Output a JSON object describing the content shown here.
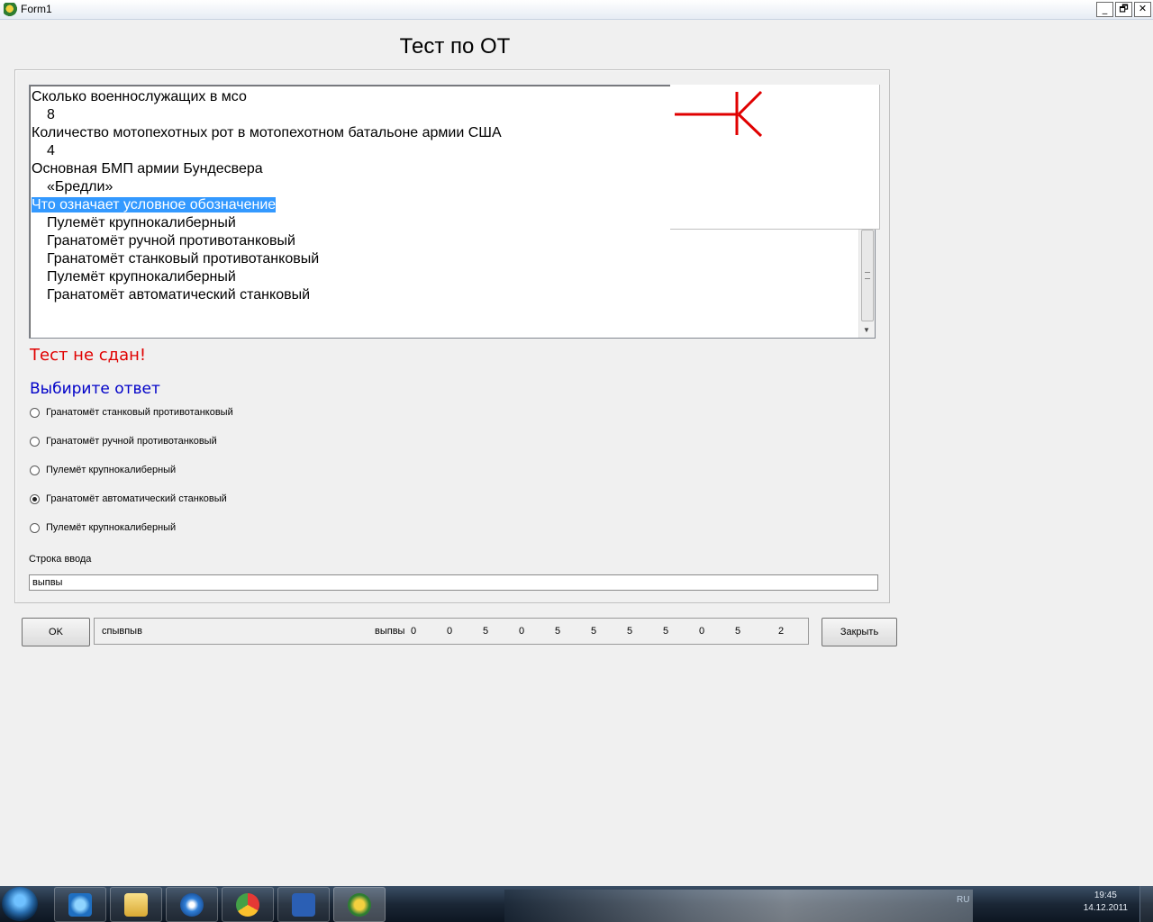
{
  "window": {
    "title": "Form1",
    "controls": {
      "minimize": "_",
      "restore": "🗗",
      "close": "✕"
    }
  },
  "header": {
    "title": "Тест по ОТ"
  },
  "memo": {
    "lines": [
      {
        "text": "Сколько военнослужащих в мсо",
        "indent": false,
        "selected": false
      },
      {
        "text": "8",
        "indent": true,
        "selected": false
      },
      {
        "text": "Количество мотопехотных рот в мотопехотном батальоне армии США",
        "indent": false,
        "selected": false
      },
      {
        "text": "4",
        "indent": true,
        "selected": false
      },
      {
        "text": "Основная БМП армии Бундесвера",
        "indent": false,
        "selected": false
      },
      {
        "text": "«Бредли»",
        "indent": true,
        "selected": false
      },
      {
        "text": "Что означает условное обозначение",
        "indent": false,
        "selected": true
      },
      {
        "text": "Пулемёт крупнокалиберный",
        "indent": true,
        "selected": false
      },
      {
        "text": "Гранатомёт ручной противотанковый",
        "indent": true,
        "selected": false
      },
      {
        "text": "Гранатомёт станковый противотанковый",
        "indent": true,
        "selected": false
      },
      {
        "text": "Пулемёт крупнокалиберный",
        "indent": true,
        "selected": false
      },
      {
        "text": "Гранатомёт автоматический станковый",
        "indent": true,
        "selected": false
      }
    ]
  },
  "symbol": {
    "color": "#e00000"
  },
  "result": {
    "text": "Тест не сдан!",
    "color": "#e00000"
  },
  "answers": {
    "label": "Выбирите ответ",
    "options": [
      {
        "text": "Гранатомёт станковый противотанковый",
        "checked": false
      },
      {
        "text": "Гранатомёт ручной противотанковый",
        "checked": false
      },
      {
        "text": "Пулемёт крупнокалиберный",
        "checked": false
      },
      {
        "text": "Гранатомёт автоматический станковый",
        "checked": true
      },
      {
        "text": "Пулемёт крупнокалиберный",
        "checked": false
      }
    ]
  },
  "input": {
    "label": "Строка ввода",
    "value": "выпвы"
  },
  "buttons": {
    "ok": "OK",
    "close": "Закрыть"
  },
  "status": {
    "left_text": "спывпыв",
    "middle_text": "выпвы",
    "numbers": [
      "0",
      "0",
      "5",
      "0",
      "5",
      "5",
      "5",
      "5",
      "0",
      "5",
      "2"
    ]
  },
  "taskbar": {
    "apps": [
      "internet-explorer",
      "file-explorer",
      "media-player",
      "chrome",
      "word",
      "delphi-app"
    ],
    "tray": {
      "lang": "RU",
      "time": "19:45",
      "date": "14.12.2011"
    }
  }
}
